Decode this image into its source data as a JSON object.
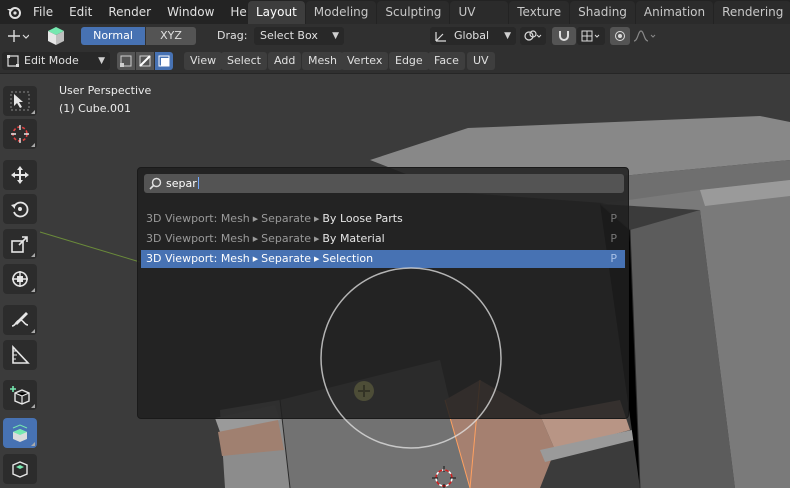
{
  "menus": [
    "File",
    "Edit",
    "Render",
    "Window",
    "Help"
  ],
  "workspaces": [
    "Layout",
    "Modeling",
    "Sculpting",
    "UV Editing",
    "Texture Paint",
    "Shading",
    "Animation",
    "Rendering"
  ],
  "active_workspace": "Layout",
  "header": {
    "orient_normal": "Normal",
    "orient_xyz": "XYZ",
    "drag_label": "Drag:",
    "drag_value": "Select Box",
    "transform_orientation": "Global"
  },
  "header2": {
    "mode": "Edit Mode",
    "menus": [
      "View",
      "Select",
      "Add",
      "Mesh",
      "Vertex",
      "Edge",
      "Face",
      "UV"
    ]
  },
  "viewport": {
    "perspective": "User Perspective",
    "object": "(1) Cube.001"
  },
  "search": {
    "query": "separ",
    "results": [
      {
        "prefix": "3D Viewport: Mesh",
        "mid": "Separate",
        "name": "By Loose Parts",
        "key": "P",
        "selected": false
      },
      {
        "prefix": "3D Viewport: Mesh",
        "mid": "Separate",
        "name": "By Material",
        "key": "P",
        "selected": false
      },
      {
        "prefix": "3D Viewport: Mesh",
        "mid": "Separate",
        "name": "Selection",
        "key": "P",
        "selected": true
      }
    ]
  },
  "tools": [
    "select-box",
    "cursor",
    "move",
    "rotate",
    "scale",
    "transform",
    "annotate",
    "measure",
    "add-cube",
    "extrude-region",
    "inset-faces"
  ],
  "active_tool": "extrude-region",
  "colors": {
    "accent": "#4772b3",
    "background": "#393939",
    "menubar": "#232323"
  }
}
